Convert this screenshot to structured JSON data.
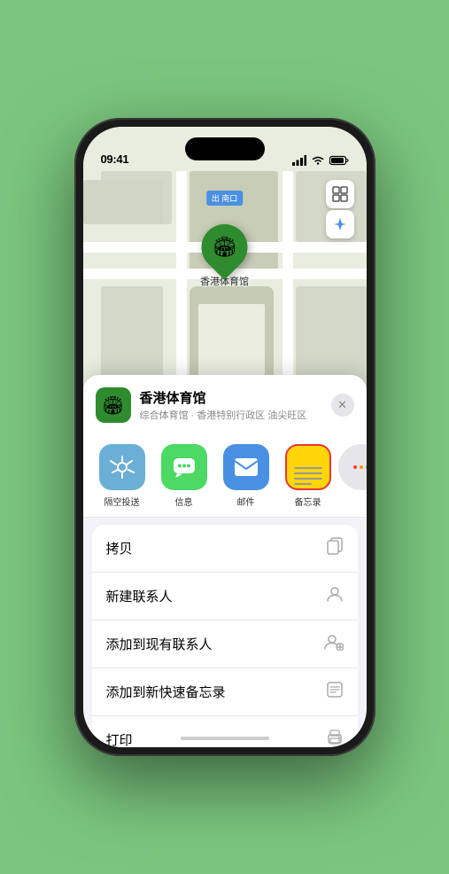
{
  "status_bar": {
    "time": "09:41",
    "signal": "●●●●",
    "wifi": "WiFi",
    "battery": "Battery"
  },
  "map": {
    "south_gate_label": "南口",
    "south_gate_prefix": "出",
    "marker_label": "香港体育馆"
  },
  "venue_card": {
    "name": "香港体育馆",
    "subtitle": "综合体育馆 · 香港特别行政区 油尖旺区",
    "close_label": "✕"
  },
  "share_items": [
    {
      "id": "airdrop",
      "label": "隔空投送",
      "icon": "📡"
    },
    {
      "id": "messages",
      "label": "信息",
      "icon": "💬"
    },
    {
      "id": "mail",
      "label": "邮件",
      "icon": "✉"
    },
    {
      "id": "notes",
      "label": "备忘录",
      "icon": "notes"
    }
  ],
  "actions": [
    {
      "id": "copy",
      "label": "拷贝",
      "icon": "⧉"
    },
    {
      "id": "new-contact",
      "label": "新建联系人",
      "icon": "👤"
    },
    {
      "id": "add-contact",
      "label": "添加到现有联系人",
      "icon": "👤+"
    },
    {
      "id": "quick-notes",
      "label": "添加到新快速备忘录",
      "icon": "📋"
    },
    {
      "id": "print",
      "label": "打印",
      "icon": "🖨"
    }
  ],
  "icons": {
    "map_view": "🗺",
    "location": "➤",
    "copy": "⊡",
    "new_contact": "⊙",
    "add_existing": "⊕",
    "quick_note": "⊞",
    "print": "⎙"
  }
}
